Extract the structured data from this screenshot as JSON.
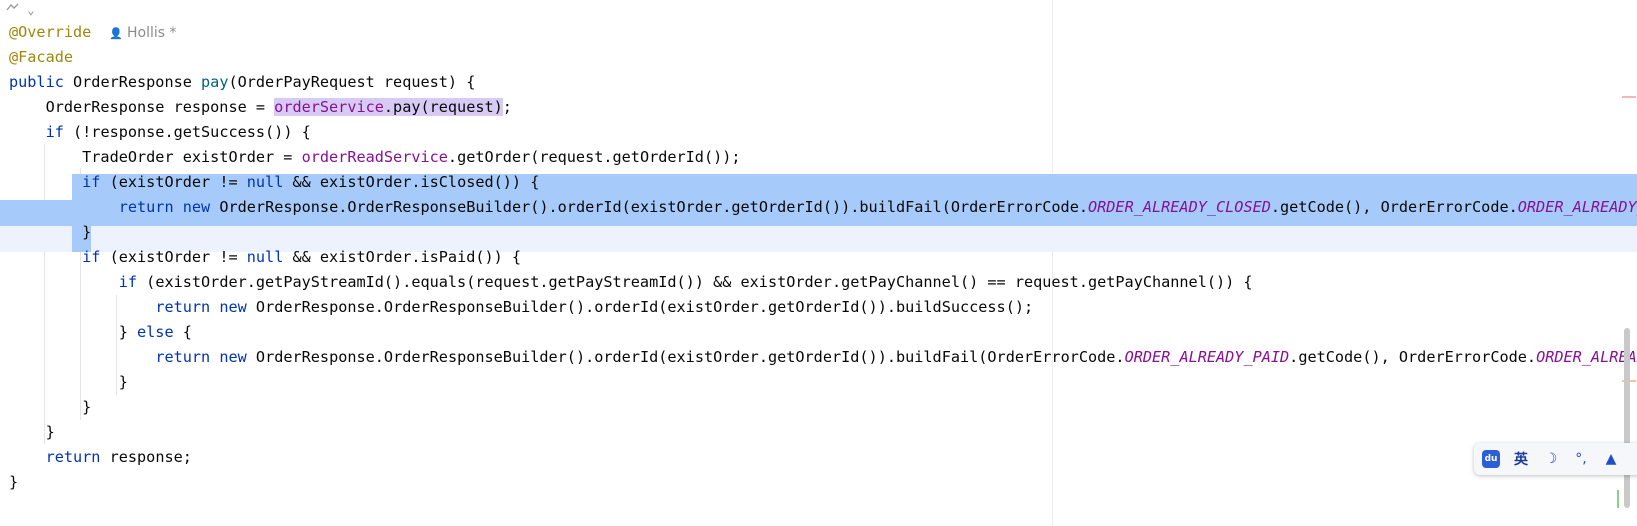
{
  "editor": {
    "author_name": "Hollis *",
    "icons": {
      "top_gutter": "gutter-menu-icon",
      "author": "person-icon"
    },
    "colors": {
      "selection": "#a6cbfb",
      "keyword": "#0033b3",
      "annotation": "#9e880d",
      "field": "#871094",
      "method": "#00627a"
    },
    "lines": [
      [
        {
          "t": "@Override",
          "c": "ann"
        }
      ],
      [
        {
          "t": "@Facade",
          "c": "ann"
        }
      ],
      [
        {
          "t": "public",
          "c": "kw"
        },
        {
          "t": " OrderResponse "
        },
        {
          "t": "pay",
          "c": "fn"
        },
        {
          "t": "(OrderPayRequest request) {"
        }
      ],
      [
        {
          "t": "    OrderResponse response = "
        },
        {
          "t": "orderService",
          "c": "fld hl-usage"
        },
        {
          "t": ".pay(request)",
          "c": "hl-usage"
        },
        {
          "t": ";"
        }
      ],
      [
        {
          "t": "    "
        },
        {
          "t": "if",
          "c": "kw"
        },
        {
          "t": " (!response.getSuccess()) {"
        }
      ],
      [
        {
          "t": "        TradeOrder existOrder = "
        },
        {
          "t": "orderReadService",
          "c": "fld"
        },
        {
          "t": ".getOrder(request.getOrderId());"
        }
      ],
      [
        {
          "t": "        "
        },
        {
          "t": "if",
          "c": "kw"
        },
        {
          "t": " (existOrder != "
        },
        {
          "t": "null",
          "c": "kw"
        },
        {
          "t": " && existOrder.isClosed()) {"
        }
      ],
      [
        {
          "t": "            "
        },
        {
          "t": "return",
          "c": "kw"
        },
        {
          "t": " "
        },
        {
          "t": "new",
          "c": "kw"
        },
        {
          "t": " OrderResponse.OrderResponseBuilder().orderId(existOrder.getOrderId()).buildFail(OrderErrorCode."
        },
        {
          "t": "ORDER_ALREADY_CLOSED",
          "c": "cst"
        },
        {
          "t": ".getCode(), OrderErrorCode."
        },
        {
          "t": "ORDER_ALREADY_CLOSED",
          "c": "cst"
        }
      ],
      [
        {
          "t": "        }"
        }
      ],
      [
        {
          "t": "        "
        },
        {
          "t": "if",
          "c": "kw"
        },
        {
          "t": " (existOrder != "
        },
        {
          "t": "null",
          "c": "kw"
        },
        {
          "t": " && existOrder.isPaid()) {"
        }
      ],
      [
        {
          "t": "            "
        },
        {
          "t": "if",
          "c": "kw"
        },
        {
          "t": " (existOrder.getPayStreamId().equals(request.getPayStreamId()) && existOrder.getPayChannel() == request.getPayChannel()) {"
        }
      ],
      [
        {
          "t": "                "
        },
        {
          "t": "return",
          "c": "kw"
        },
        {
          "t": " "
        },
        {
          "t": "new",
          "c": "kw"
        },
        {
          "t": " OrderResponse.OrderResponseBuilder().orderId(existOrder.getOrderId()).buildSuccess();"
        }
      ],
      [
        {
          "t": "            } "
        },
        {
          "t": "else",
          "c": "kw"
        },
        {
          "t": " {"
        }
      ],
      [
        {
          "t": "                "
        },
        {
          "t": "return",
          "c": "kw"
        },
        {
          "t": " "
        },
        {
          "t": "new",
          "c": "kw"
        },
        {
          "t": " OrderResponse.OrderResponseBuilder().orderId(existOrder.getOrderId()).buildFail(OrderErrorCode."
        },
        {
          "t": "ORDER_ALREADY_PAID",
          "c": "cst"
        },
        {
          "t": ".getCode(), OrderErrorCode."
        },
        {
          "t": "ORDER_ALREADY_PAID",
          "c": "cst"
        }
      ],
      [
        {
          "t": "            }"
        }
      ],
      [
        {
          "t": "        }"
        }
      ],
      [
        {
          "t": "    }"
        }
      ],
      [
        {
          "t": "    "
        },
        {
          "t": "return",
          "c": "kw"
        },
        {
          "t": " response;"
        }
      ],
      [
        {
          "t": "}"
        }
      ]
    ]
  },
  "ime_toolbar": {
    "logo_text": "du",
    "language": "英",
    "icons": [
      "ime-logo-icon",
      "language-toggle-icon",
      "moon-icon",
      "punctuation-icon",
      "skin-icon"
    ],
    "moon_glyph": "☽",
    "punct_glyph": "°,",
    "skin_glyph": "▲"
  }
}
